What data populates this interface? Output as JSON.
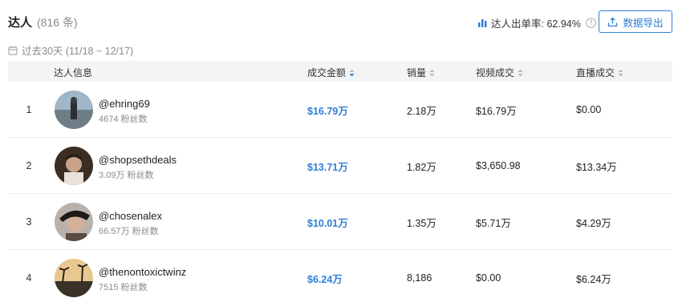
{
  "header": {
    "title": "达人",
    "count": "(816 条)",
    "rate_label": "达人出单率: 62.94%",
    "export_label": "数据导出"
  },
  "period": "过去30天 (11/18 ~ 12/17)",
  "columns": {
    "creator": "达人信息",
    "gmv": "成交金额",
    "sales": "销量",
    "video": "视频成交",
    "live": "直播成交"
  },
  "rows": [
    {
      "index": "1",
      "name": "@ehring69",
      "fans": "4674 粉丝数",
      "gmv": "$16.79万",
      "sales": "2.18万",
      "video": "$16.79万",
      "live": "$0.00"
    },
    {
      "index": "2",
      "name": "@shopsethdeals",
      "fans": "3.09万 粉丝数",
      "gmv": "$13.71万",
      "sales": "1.82万",
      "video": "$3,650.98",
      "live": "$13.34万"
    },
    {
      "index": "3",
      "name": "@chosenalex",
      "fans": "66.57万 粉丝数",
      "gmv": "$10.01万",
      "sales": "1.35万",
      "video": "$5.71万",
      "live": "$4.29万"
    },
    {
      "index": "4",
      "name": "@thenontoxictwinz",
      "fans": "7515 粉丝数",
      "gmv": "$6.24万",
      "sales": "8,186",
      "video": "$0.00",
      "live": "$6.24万"
    }
  ],
  "colors": {
    "accent": "#2f7ed8",
    "muted": "#8a8a8a",
    "header_bg": "#f3f4f6"
  },
  "icons": {
    "rate": "bar-chart-icon",
    "help": "question-circle-icon",
    "export": "upload-icon",
    "period": "calendar-icon",
    "sort": "sort-icon"
  }
}
